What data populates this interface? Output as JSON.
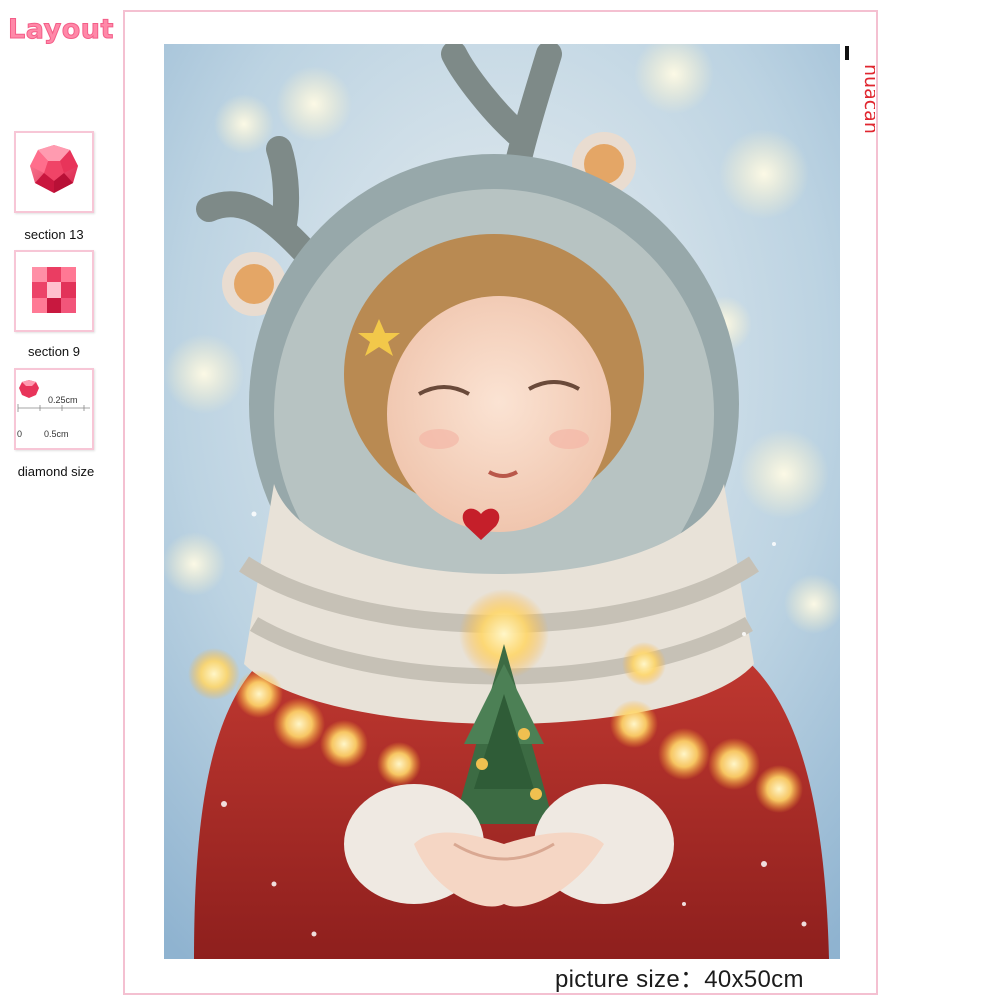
{
  "header": {
    "title": "Layout"
  },
  "swatches": [
    {
      "label": "section 13",
      "icon": "round-drill-icon"
    },
    {
      "label": "section 9",
      "icon": "square-drill-icon"
    }
  ],
  "diamond_size": {
    "label": "diamond size",
    "ruler_small": "0.25cm",
    "ruler_zero": "0",
    "ruler_large": "0.5cm"
  },
  "brand": {
    "name": "huacan"
  },
  "artwork": {
    "subject": "girl-holding-christmas-tree-icon",
    "caption": "picture size：40x50cm"
  },
  "colors": {
    "accent_pink": "#f35e88",
    "frame_pink": "#f4c0d1",
    "brand_red": "#e0262f"
  }
}
